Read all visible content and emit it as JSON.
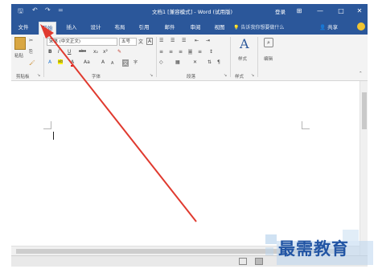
{
  "window": {
    "title": "文档1 [兼容模式] - Word (试用版)",
    "login_label": "登录",
    "quick_access": {
      "save": "🖫",
      "undo": "↶",
      "redo": "↷",
      "more": "="
    },
    "controls": {
      "ribbon_options": "⊞",
      "minimize": "—",
      "maximize": "□",
      "close": "✕"
    }
  },
  "tabs": [
    {
      "label": "文件"
    },
    {
      "label": "开始"
    },
    {
      "label": "插入"
    },
    {
      "label": "设计"
    },
    {
      "label": "布局"
    },
    {
      "label": "引用"
    },
    {
      "label": "邮件"
    },
    {
      "label": "审阅"
    },
    {
      "label": "视图"
    }
  ],
  "active_tab": "开始",
  "tell_me": "告诉我你想要做什么",
  "share_label": "共享",
  "ribbon": {
    "clipboard": {
      "paste_label": "粘贴",
      "group_label": "剪贴板"
    },
    "font": {
      "font_name": "宋体 (中文正文)",
      "font_size": "五号",
      "group_label": "字体",
      "bold": "B",
      "italic": "I",
      "underline": "U",
      "strike": "abc",
      "subscript": "x₂",
      "superscript": "x²",
      "grow": "A",
      "shrink": "A",
      "aa": "Aa",
      "font_color": "A",
      "highlight": "ab",
      "char_border": "A",
      "wen": "文",
      "phonetic": "wén",
      "clear": "✎",
      "enclose": "字"
    },
    "paragraph": {
      "group_label": "段落"
    },
    "styles": {
      "styles_label": "样式",
      "group_label": "样式"
    },
    "editing": {
      "editing_label": "编辑"
    }
  },
  "watermark": {
    "text": "最需教育"
  },
  "colors": {
    "word_blue": "#2b579a",
    "ribbon_bg": "#f3f3f3",
    "arrow_red": "#e03a2f",
    "watermark_text": "#2255a4"
  }
}
